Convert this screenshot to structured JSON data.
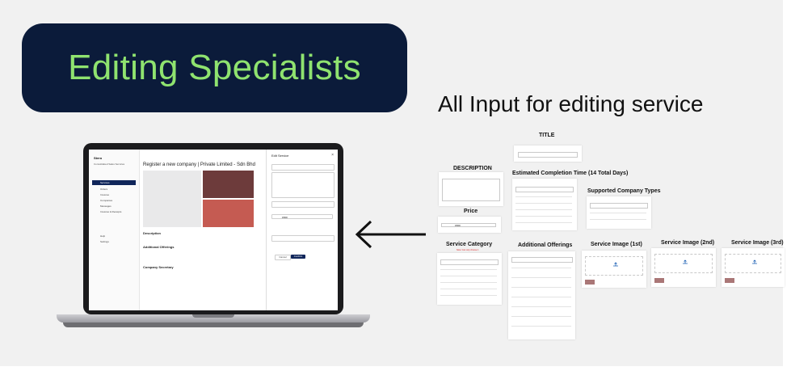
{
  "banner": {
    "title": "Editing Specialists"
  },
  "subtitle": "All Input for editing service",
  "colors": {
    "banner_bg": "#0b1b3a",
    "banner_text": "#8fe36f",
    "sidebar_active": "#10265a",
    "primary_button": "#10265a"
  },
  "laptop": {
    "sidebar": {
      "logo": "Stero",
      "company": "Consolidated Sales Services",
      "items": [
        "Services",
        "Orders",
        "Invoices",
        "Companies",
        "Messages",
        "Invoices & Receipts"
      ],
      "bottom_items": [
        "Help",
        "Settings"
      ]
    },
    "main": {
      "page_title": "Register a new company | Private Limited - Sdn Bhd",
      "section_description": "Description",
      "section_offerings": "Additional Offerings",
      "section_secretary": "Company Secretary"
    },
    "modal": {
      "title": "Edit Service",
      "close_icon": "×",
      "fields": [
        "Title",
        "Description",
        "Estimated Completion Time (days)",
        "Price",
        "Additional Offerings"
      ],
      "price_value": "1500",
      "cancel": "Cancel",
      "confirm": "Confirm"
    }
  },
  "cards": {
    "title": {
      "label": "TITLE"
    },
    "description": {
      "label": "DESCRIPTION"
    },
    "completion": {
      "label": "Estimated Completion Time (14 Total Days)"
    },
    "company_types": {
      "label": "Supported Company Types"
    },
    "price": {
      "label": "Price",
      "value": "1500"
    },
    "category": {
      "label": "Service Category",
      "note": "Note: Can only choose 1"
    },
    "offerings": {
      "label": "Additional Offerings"
    },
    "image1": {
      "label": "Service Image (1st)"
    },
    "image2": {
      "label": "Service Image (2nd)"
    },
    "image3": {
      "label": "Service Image (3rd)"
    }
  },
  "icons": [
    "arrow-left-icon",
    "close-icon",
    "upload-icon",
    "service-icon",
    "user-icon"
  ]
}
